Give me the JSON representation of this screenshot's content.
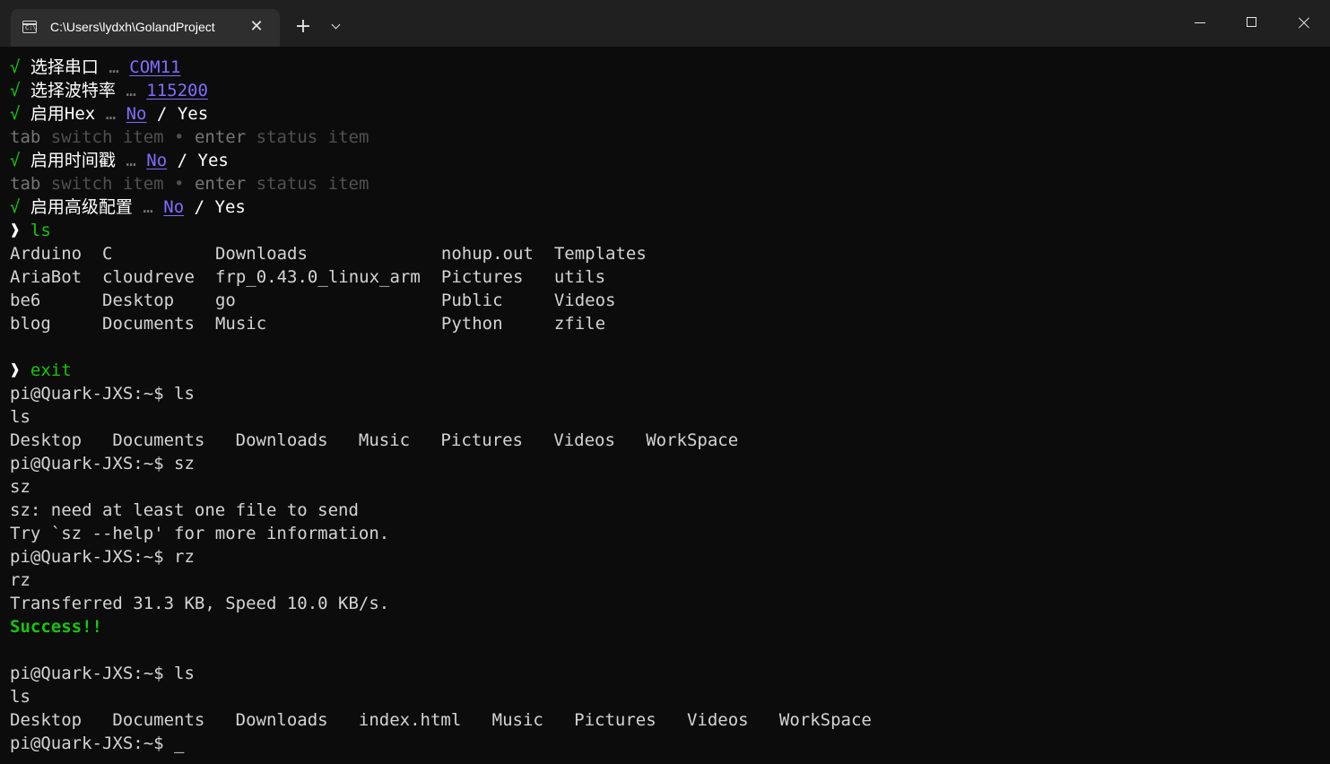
{
  "window": {
    "tab_title": "C:\\Users\\lydxh\\GolandProject",
    "tab_icon_text": "C:\\"
  },
  "colors": {
    "background": "#0c0c0c",
    "titlebar": "#202020",
    "prompt_green": "#16c60c",
    "link_purple": "#7f6dff",
    "text": "#d4d4d4"
  },
  "terminal": {
    "wizard": [
      {
        "check": "√",
        "label": "选择串口",
        "ell": "…",
        "value": "COM11"
      },
      {
        "check": "√",
        "label": "选择波特率",
        "ell": "…",
        "value": "115200"
      }
    ],
    "hex": {
      "check": "√",
      "label": "启用Hex",
      "ell": "…",
      "no": "No",
      "sep": " / ",
      "yes": "Yes"
    },
    "hint1": {
      "tab": "tab",
      "switch": " switch item",
      "dot": " • ",
      "enter": "enter",
      "status": " status item"
    },
    "timestamp": {
      "check": "√",
      "label": "启用时间戳",
      "ell": "…",
      "no": "No",
      "sep": " / ",
      "yes": "Yes"
    },
    "hint2": {
      "tab": "tab",
      "switch": " switch item",
      "dot": " • ",
      "enter": "enter",
      "status": " status item"
    },
    "advanced": {
      "check": "√",
      "label": "启用高级配置",
      "ell": "…",
      "no": "No",
      "sep": " / ",
      "yes": "Yes"
    },
    "ls_prompt": {
      "arrow": "❱",
      "cmd": "ls"
    },
    "ls_grid": [
      [
        "Arduino",
        "C",
        "Downloads",
        "nohup.out",
        "Templates"
      ],
      [
        "AriaBot",
        "cloudreve",
        "frp_0.43.0_linux_arm",
        "Pictures",
        "utils"
      ],
      [
        "be6",
        "Desktop",
        "go",
        "Public",
        "Videos"
      ],
      [
        "blog",
        "Documents",
        "Music",
        "Python",
        "zfile"
      ]
    ],
    "exit_prompt": {
      "arrow": "❱",
      "cmd": "exit"
    },
    "session": [
      "pi@Quark-JXS:~$ ls",
      "ls",
      "Desktop   Documents   Downloads   Music   Pictures   Videos   WorkSpace",
      "pi@Quark-JXS:~$ sz",
      "sz",
      "sz: need at least one file to send",
      "Try `sz --help' for more information.",
      "pi@Quark-JXS:~$ rz",
      "rz",
      "Transferred 31.3 KB, Speed 10.0 KB/s."
    ],
    "success": "Success!!",
    "session2": [
      "pi@Quark-JXS:~$ ls",
      "ls",
      "Desktop   Documents   Downloads   index.html   Music   Pictures   Videos   WorkSpace"
    ],
    "final_prompt": "pi@Quark-JXS:~$ ",
    "cursor": "_"
  }
}
